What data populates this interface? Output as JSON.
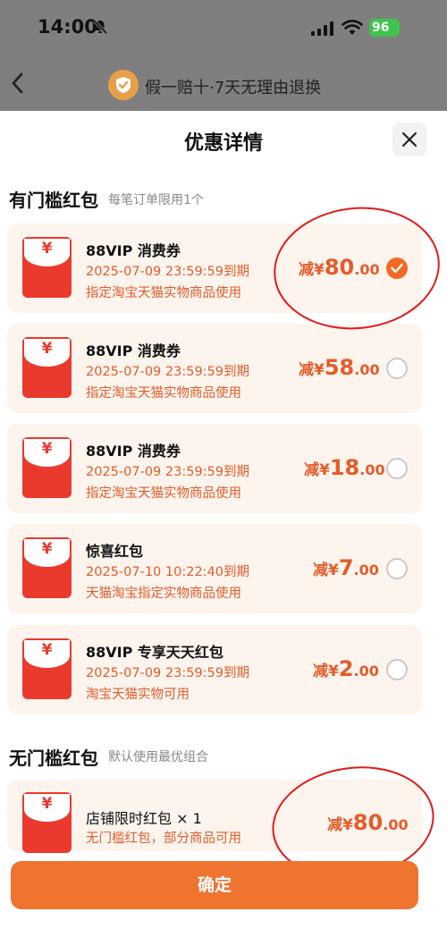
{
  "status": {
    "time": "14:00",
    "battery": "96"
  },
  "header": {
    "promise": "假一赔十·7天无理由退换"
  },
  "sheet": {
    "title": "优惠详情"
  },
  "threshold": {
    "title": "有门槛红包",
    "subtitle": "每笔订单限用1个",
    "coupons": [
      {
        "name": "88VIP 消费券",
        "expiry": "2025-07-09 23:59:59到期",
        "scope": "指定淘宝天猫实物商品使用",
        "prefix": "减",
        "yen": "¥",
        "int": "80",
        "dec": ".00",
        "selected": true
      },
      {
        "name": "88VIP 消费券",
        "expiry": "2025-07-09 23:59:59到期",
        "scope": "指定淘宝天猫实物商品使用",
        "prefix": "减",
        "yen": "¥",
        "int": "58",
        "dec": ".00",
        "selected": false
      },
      {
        "name": "88VIP 消费券",
        "expiry": "2025-07-09 23:59:59到期",
        "scope": "指定淘宝天猫实物商品使用",
        "prefix": "减",
        "yen": "¥",
        "int": "18",
        "dec": ".00",
        "selected": false
      },
      {
        "name": "惊喜红包",
        "expiry": "2025-07-10 10:22:40到期",
        "scope": "天猫淘宝指定实物商品使用",
        "prefix": "减",
        "yen": "¥",
        "int": "7",
        "dec": ".00",
        "selected": false
      },
      {
        "name": "88VIP 专享天天红包",
        "expiry": "2025-07-09 23:59:59到期",
        "scope": "淘宝天猫实物可用",
        "prefix": "减",
        "yen": "¥",
        "int": "2",
        "dec": ".00",
        "selected": false
      }
    ]
  },
  "no_threshold": {
    "title": "无门槛红包",
    "subtitle": "默认使用最优组合",
    "coupon": {
      "name": "店铺限时红包 × 1",
      "scope": "无门槛红包，部分商品可用",
      "prefix": "减",
      "yen": "¥",
      "int": "80",
      "dec": ".00"
    }
  },
  "envelope_symbol": "¥",
  "confirm_label": "确定",
  "colors": {
    "accent": "#ee742f",
    "discount": "#e45c29",
    "envelope": "#ea3a2d",
    "card_bg": "#fdf4ee",
    "annotation": "#e11b1b"
  }
}
